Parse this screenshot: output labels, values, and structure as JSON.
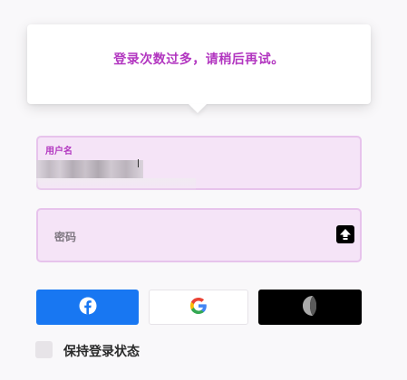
{
  "error_tooltip": {
    "message": "登录次数过多，请稍后再试。"
  },
  "username_field": {
    "label": "用户名",
    "value_state": "blurred"
  },
  "password_field": {
    "placeholder": "密码",
    "indicator_icon": "caps-lock-icon"
  },
  "social_login": [
    {
      "provider": "facebook",
      "icon": "facebook-icon",
      "color": "#1877f2"
    },
    {
      "provider": "google",
      "icon": "google-icon",
      "color": "#ffffff"
    },
    {
      "provider": "apple",
      "icon": "apple-icon",
      "color": "#000000"
    }
  ],
  "remember_me": {
    "label": "保持登录状态",
    "checked": false
  },
  "colors": {
    "accent": "#b236c0",
    "field_bg": "#f5e4f7",
    "field_border": "#e7c3ec"
  }
}
